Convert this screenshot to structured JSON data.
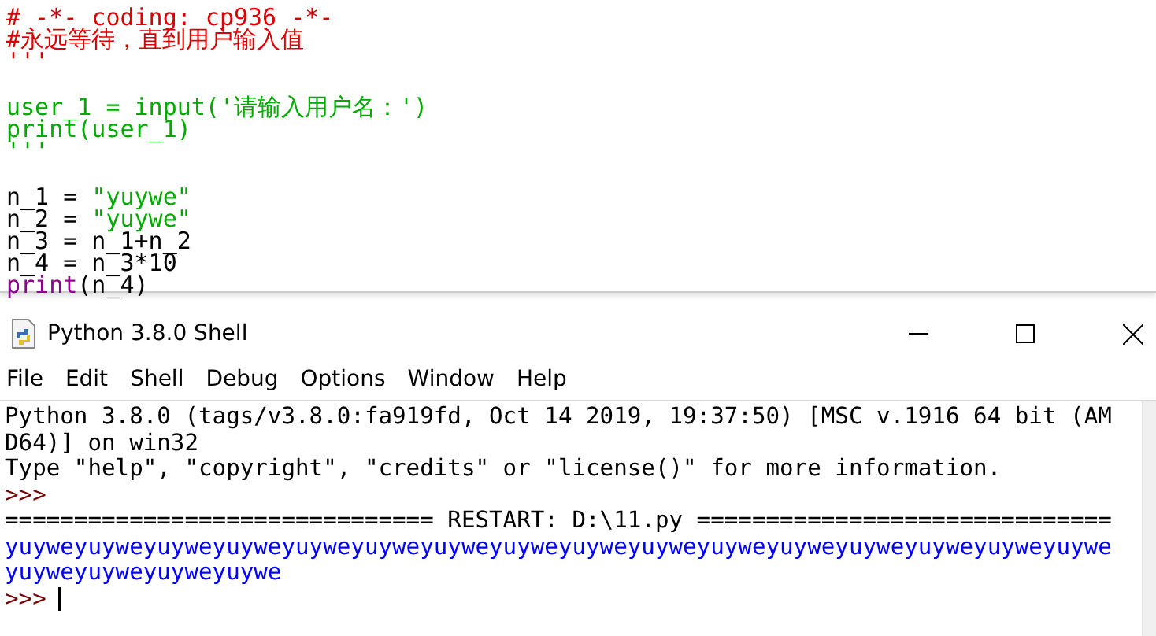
{
  "editor": {
    "lines": [
      [
        {
          "text": "# -*- coding: cp936 -*-",
          "kind": "comment"
        }
      ],
      [
        {
          "text": "#永远等待，直到用户输入值",
          "kind": "comment"
        }
      ],
      [
        {
          "text": "'''",
          "kind": "comment"
        }
      ],
      [
        {
          "kind": "blank"
        }
      ],
      [
        {
          "text": "user_1 = input('请输入用户名：')",
          "kind": "string"
        }
      ],
      [
        {
          "text": "print(user_1)",
          "kind": "string"
        }
      ],
      [
        {
          "text": "'''",
          "kind": "string"
        }
      ],
      [
        {
          "kind": "blank"
        }
      ],
      [
        {
          "text": "n_1 = ",
          "kind": "plain"
        },
        {
          "text": "\"yuywe\"",
          "kind": "string"
        }
      ],
      [
        {
          "text": "n_2 = ",
          "kind": "plain"
        },
        {
          "text": "\"yuywe\"",
          "kind": "string"
        }
      ],
      [
        {
          "text": "n_3 = n_1+n_2",
          "kind": "plain"
        }
      ],
      [
        {
          "text": "n_4 = n_3*10",
          "kind": "plain"
        }
      ],
      [
        {
          "text": "print",
          "kind": "builtin"
        },
        {
          "text": "(n_4)",
          "kind": "plain"
        }
      ]
    ]
  },
  "window": {
    "title": "Python 3.8.0 Shell"
  },
  "menu": [
    "File",
    "Edit",
    "Shell",
    "Debug",
    "Options",
    "Window",
    "Help"
  ],
  "shell": {
    "lines": [
      [
        {
          "text": "Python 3.8.0 (tags/v3.8.0:fa919fd, Oct 14 2019, 19:37:50) [MSC v.1916 64 bit (AM",
          "kind": "plain"
        }
      ],
      [
        {
          "text": "D64)] on win32",
          "kind": "plain"
        }
      ],
      [
        {
          "text": "Type \"help\", \"copyright\", \"credits\" or \"license()\" for more information.",
          "kind": "plain"
        }
      ],
      [
        {
          "text": ">>>",
          "kind": "prompt"
        }
      ],
      [
        {
          "text": "=============================== RESTART: D:\\11.py ==============================",
          "kind": "plain"
        }
      ],
      [
        {
          "text": "yuyweyuyweyuyweyuyweyuyweyuyweyuyweyuyweyuyweyuyweyuyweyuyweyuyweyuyweyuyweyuywe",
          "kind": "stdout"
        }
      ],
      [
        {
          "text": "yuyweyuyweyuyweyuywe",
          "kind": "stdout"
        }
      ],
      [
        {
          "text": ">>>",
          "kind": "prompt"
        },
        {
          "kind": "cursor"
        }
      ]
    ]
  }
}
